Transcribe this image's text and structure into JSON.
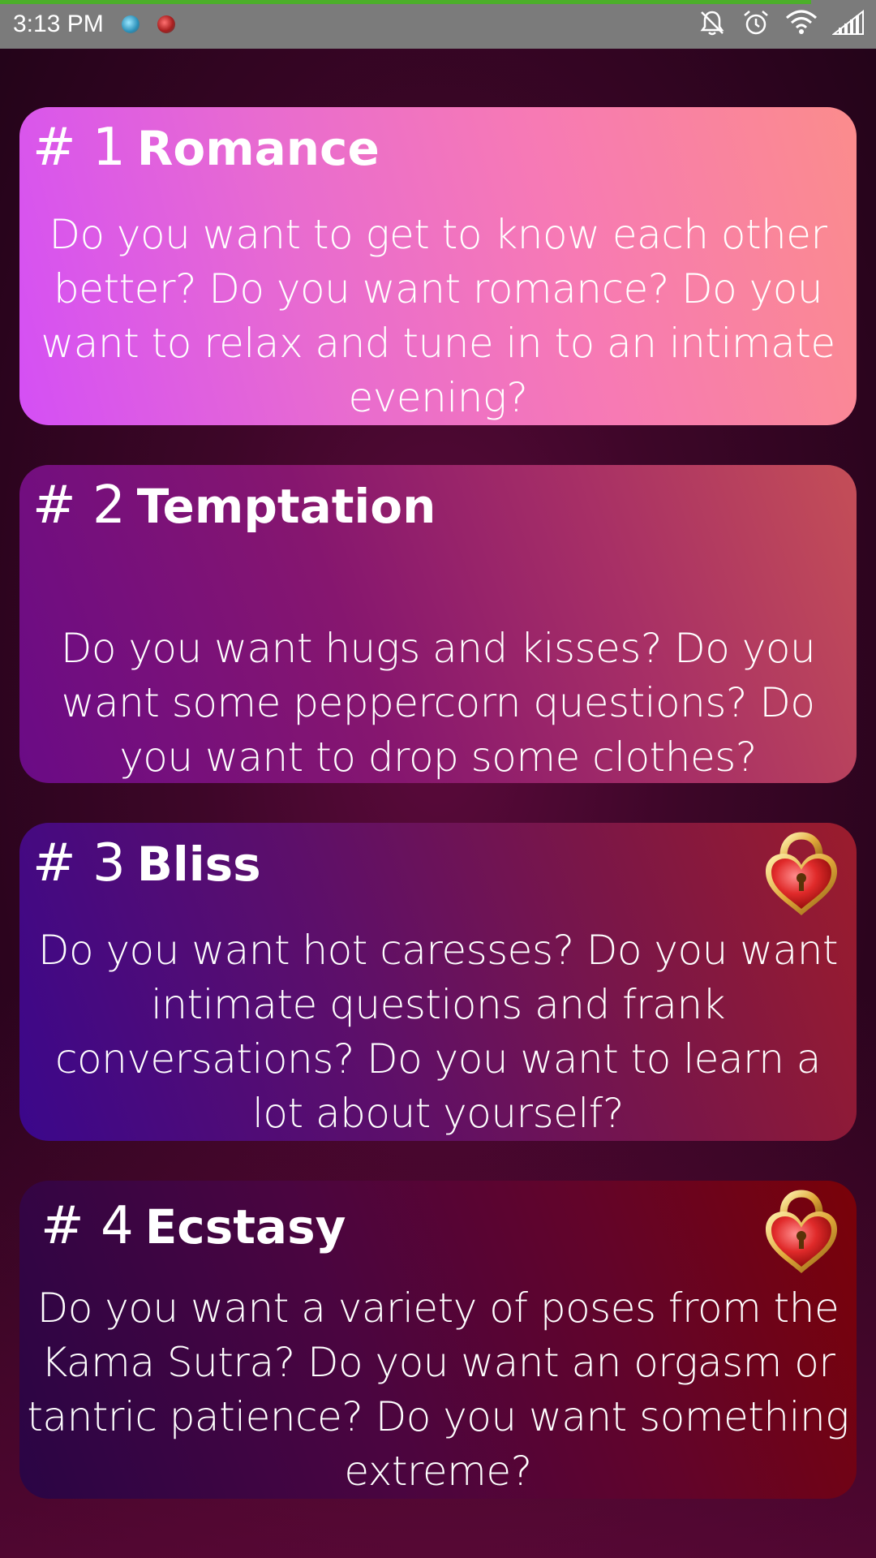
{
  "status_bar": {
    "time": "3:13 PM",
    "icons": [
      "app-notification-icon",
      "app-notification-icon-2",
      "mute-icon",
      "alarm-icon",
      "wifi-icon",
      "signal-icon"
    ]
  },
  "colors": {
    "card1": "#e86bd0",
    "card2": "#86166f",
    "card3": "#5d0f6a",
    "card4": "#62042a",
    "progress": "#4caf2a"
  },
  "levels": [
    {
      "number": "# 1",
      "name": "Romance",
      "description": "Do you want to get to know each other better? Do you want romance? Do you want to relax and tune in to an intimate evening?",
      "locked": false
    },
    {
      "number": "# 2",
      "name": "Temptation",
      "description": "Do you want hugs and kisses? Do you want some peppercorn questions? Do you want to drop some clothes?",
      "locked": false
    },
    {
      "number": "# 3",
      "name": "Bliss",
      "description": "Do you want hot caresses? Do you want intimate questions and frank conversations? Do you want to learn a lot about yourself?",
      "locked": true,
      "lock_icon": "heart-lock-icon"
    },
    {
      "number": "# 4",
      "name": "Ecstasy",
      "description": "Do you want a variety of poses from the Kama Sutra? Do you want an orgasm or tantric patience? Do you want something extreme?",
      "locked": true,
      "lock_icon": "heart-lock-icon"
    }
  ]
}
